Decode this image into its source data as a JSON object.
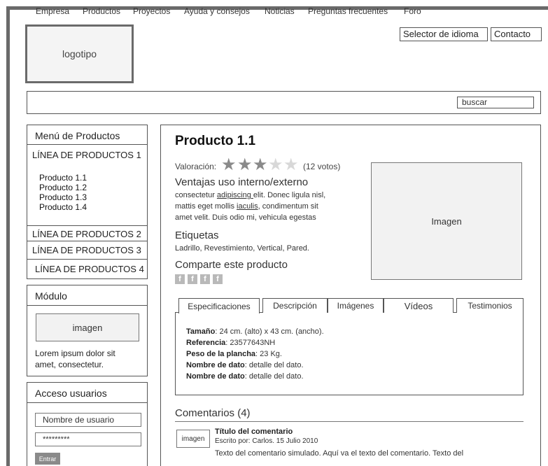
{
  "header": {
    "logo": "logotipo",
    "language_selector": "Selector de idioma",
    "contact": "Contacto"
  },
  "nav": {
    "items": [
      "Empresa",
      "Productos",
      "Proyectos",
      "Ayuda y consejos",
      "Noticias",
      "Preguntas frecuentes",
      "Foro"
    ],
    "search_placeholder": "buscar"
  },
  "sidebar": {
    "menu_title": "Menú de Productos",
    "lines": [
      "LÍNEA DE PRODUCTOS 1",
      "LÍNEA DE PRODUCTOS 2",
      "LÍNEA DE PRODUCTOS 3",
      "LÍNEA DE PRODUCTOS 4"
    ],
    "products": [
      "Producto 1.1",
      "Producto 1.2",
      "Producto 1.3",
      "Producto 1.4"
    ],
    "module": {
      "title": "Módulo",
      "image": "imagen",
      "text_line1": "Lorem ipsum dolor sit",
      "text_line2": "amet, consectetur."
    },
    "login": {
      "title": "Acceso usuarios",
      "username_placeholder": "Nombre de usuario",
      "password_value": "*********",
      "enter": "Entrar"
    }
  },
  "product": {
    "title": "Producto 1.1",
    "rating_label": "Valoración:",
    "stars_filled": 3,
    "stars_total": 5,
    "votes": "(12 votos)",
    "advantages_title": "Ventajas uso interno/externo",
    "advantages_line1_a": "consectetur ",
    "advantages_line1_link": "adipiscing ",
    "advantages_line1_b": "elit. Donec ligula nisl,",
    "advantages_line2_a": "mattis eget mollis ",
    "advantages_line2_link": "iaculis",
    "advantages_line2_b": ", condimentum sit",
    "advantages_line3": "amet velit. Duis odio mi, vehicula egestas",
    "tags_title": "Etiquetas",
    "tags": "Ladrillo, Revestimiento, Vertical, Pared.",
    "share_title": "Comparte este producto",
    "share_icon": "f",
    "image": "Imagen"
  },
  "tabs": [
    "Especificaciones",
    "Descripción",
    "Imágenes",
    "Vídeos",
    "Testimonios"
  ],
  "specs": [
    {
      "label": "Tamaño",
      "value": ": 24 cm. (alto) x 43 cm. (ancho)."
    },
    {
      "label": "Referencia",
      "value": ": 23577643NH"
    },
    {
      "label": "Peso de la plancha",
      "value": ": 23 Kg."
    },
    {
      "label": "Nombre de dato",
      "value": ": detalle del dato."
    },
    {
      "label": "Nombre de dato",
      "value": ": detalle del dato."
    }
  ],
  "comments": {
    "title": "Comentarios (4)",
    "image": "imagen",
    "item_title": "Título del comentario",
    "item_meta": "Escrito por: Carlos.   15 Julio 2010",
    "item_text": "Texto del comentario simulado. Aquí va el texto del comentario. Texto del"
  }
}
